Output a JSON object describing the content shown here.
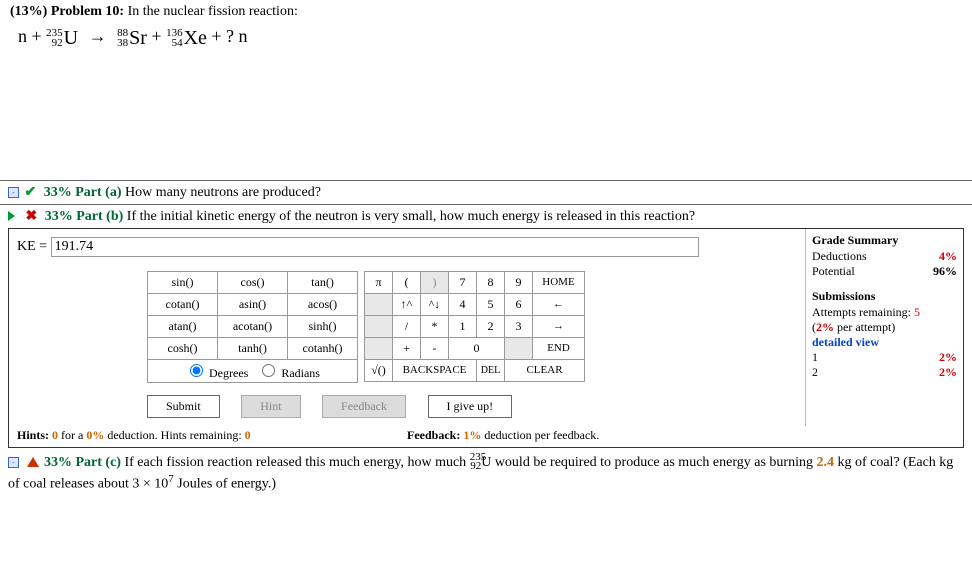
{
  "problem": {
    "header_prefix": "(13%) Problem 10:",
    "header_text": " In the nuclear fission reaction:",
    "eq": {
      "n1": "n",
      "plus1": " + ",
      "U_top": "235",
      "U_bot": "92",
      "U_sym": "U",
      "arrow": "→",
      "Sr_top": "88",
      "Sr_bot": "38",
      "Sr_sym": "Sr",
      "plus2": " + ",
      "Xe_top": "136",
      "Xe_bot": "54",
      "Xe_sym": "Xe",
      "plus3": " + ? n"
    }
  },
  "parts": {
    "a": {
      "label": "33% Part (a)",
      "text": " How many neutrons are produced?"
    },
    "b": {
      "label": "33% Part (b)",
      "text": " If the initial kinetic energy of the neutron is very small, how much energy is released in this reaction?"
    },
    "c": {
      "label": "33% Part (c)",
      "text_pre": " If each fission reaction released this much energy, how much ",
      "iso_top": "235",
      "iso_bot": "92",
      "iso_sym": "U",
      "text_mid": " would be required to produce as much energy as burning ",
      "mass": "2.4",
      "text_post": " kg of coal? (Each kg of coal releases about 3 × 10",
      "exp": "7",
      "text_end": " Joules of energy.)"
    }
  },
  "answer": {
    "label": "KE = ",
    "value": "191.74"
  },
  "grade": {
    "title": "Grade Summary",
    "deductions_label": "Deductions",
    "deductions_value": "4%",
    "potential_label": "Potential",
    "potential_value": "96%",
    "subs_title": "Submissions",
    "attempts_label": "Attempts remaining: ",
    "attempts_value": "5",
    "per_attempt_pre": "(",
    "per_attempt_val": "2%",
    "per_attempt_post": " per attempt)",
    "detailed": "detailed view",
    "rows": [
      {
        "n": "1",
        "v": "2%"
      },
      {
        "n": "2",
        "v": "2%"
      }
    ]
  },
  "fnkeys": [
    [
      "sin()",
      "cos()",
      "tan()"
    ],
    [
      "cotan()",
      "asin()",
      "acos()"
    ],
    [
      "atan()",
      "acotan()",
      "sinh()"
    ],
    [
      "cosh()",
      "tanh()",
      "cotanh()"
    ]
  ],
  "angle": {
    "degrees": "Degrees",
    "radians": "Radians"
  },
  "numpad": {
    "r1": [
      "π",
      "(",
      ")",
      "7",
      "8",
      "9"
    ],
    "r1_home": "HOME",
    "r2": [
      "",
      "↑^",
      "^↓",
      "4",
      "5",
      "6"
    ],
    "r2_end": "←",
    "r3": [
      "",
      "/",
      "*",
      "1",
      "2",
      "3"
    ],
    "r3_end": "→",
    "r4": [
      "",
      "+",
      "-",
      "0"
    ],
    "r4_end": "END",
    "r5": [
      "√()",
      "BACKSPACE",
      "DEL",
      "CLEAR"
    ]
  },
  "buttons": {
    "submit": "Submit",
    "hint": "Hint",
    "feedback": "Feedback",
    "giveup": "I give up!"
  },
  "hints": {
    "left_pre": "Hints: ",
    "left_val": "0",
    "left_mid": " for a ",
    "left_pct": "0%",
    "left_post": " deduction. Hints remaining: ",
    "left_rem": "0",
    "right_pre": "Feedback: ",
    "right_val": "1%",
    "right_post": " deduction per feedback."
  }
}
